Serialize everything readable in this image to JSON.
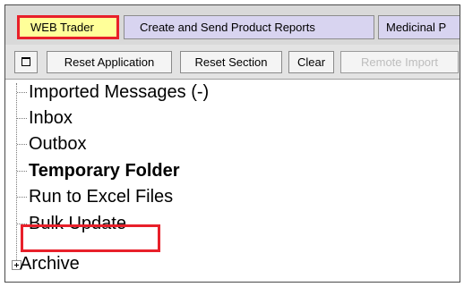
{
  "tabs": [
    {
      "label": "WEB Trader",
      "active": true
    },
    {
      "label": "Create and Send Product Reports",
      "active": false
    },
    {
      "label": "Medicinal P",
      "active": false
    }
  ],
  "toolbar": {
    "square_icon": "square-icon",
    "reset_application": "Reset Application",
    "reset_section": "Reset Section",
    "clear": "Clear",
    "remote_import": "Remote Import"
  },
  "tree": {
    "items": [
      {
        "label": "Imported Messages (-)"
      },
      {
        "label": "Inbox"
      },
      {
        "label": "Outbox"
      },
      {
        "label": "Temporary Folder"
      },
      {
        "label": "Run to Excel Files"
      },
      {
        "label": "Bulk Update"
      },
      {
        "label": "Archive"
      }
    ],
    "expander_icon": "plus-expander-icon"
  },
  "colors": {
    "highlight": "#e8202a",
    "active_tab": "#ffff99",
    "inactive_tab": "#d8d4f0",
    "disabled_text": "#bdbdbd"
  }
}
